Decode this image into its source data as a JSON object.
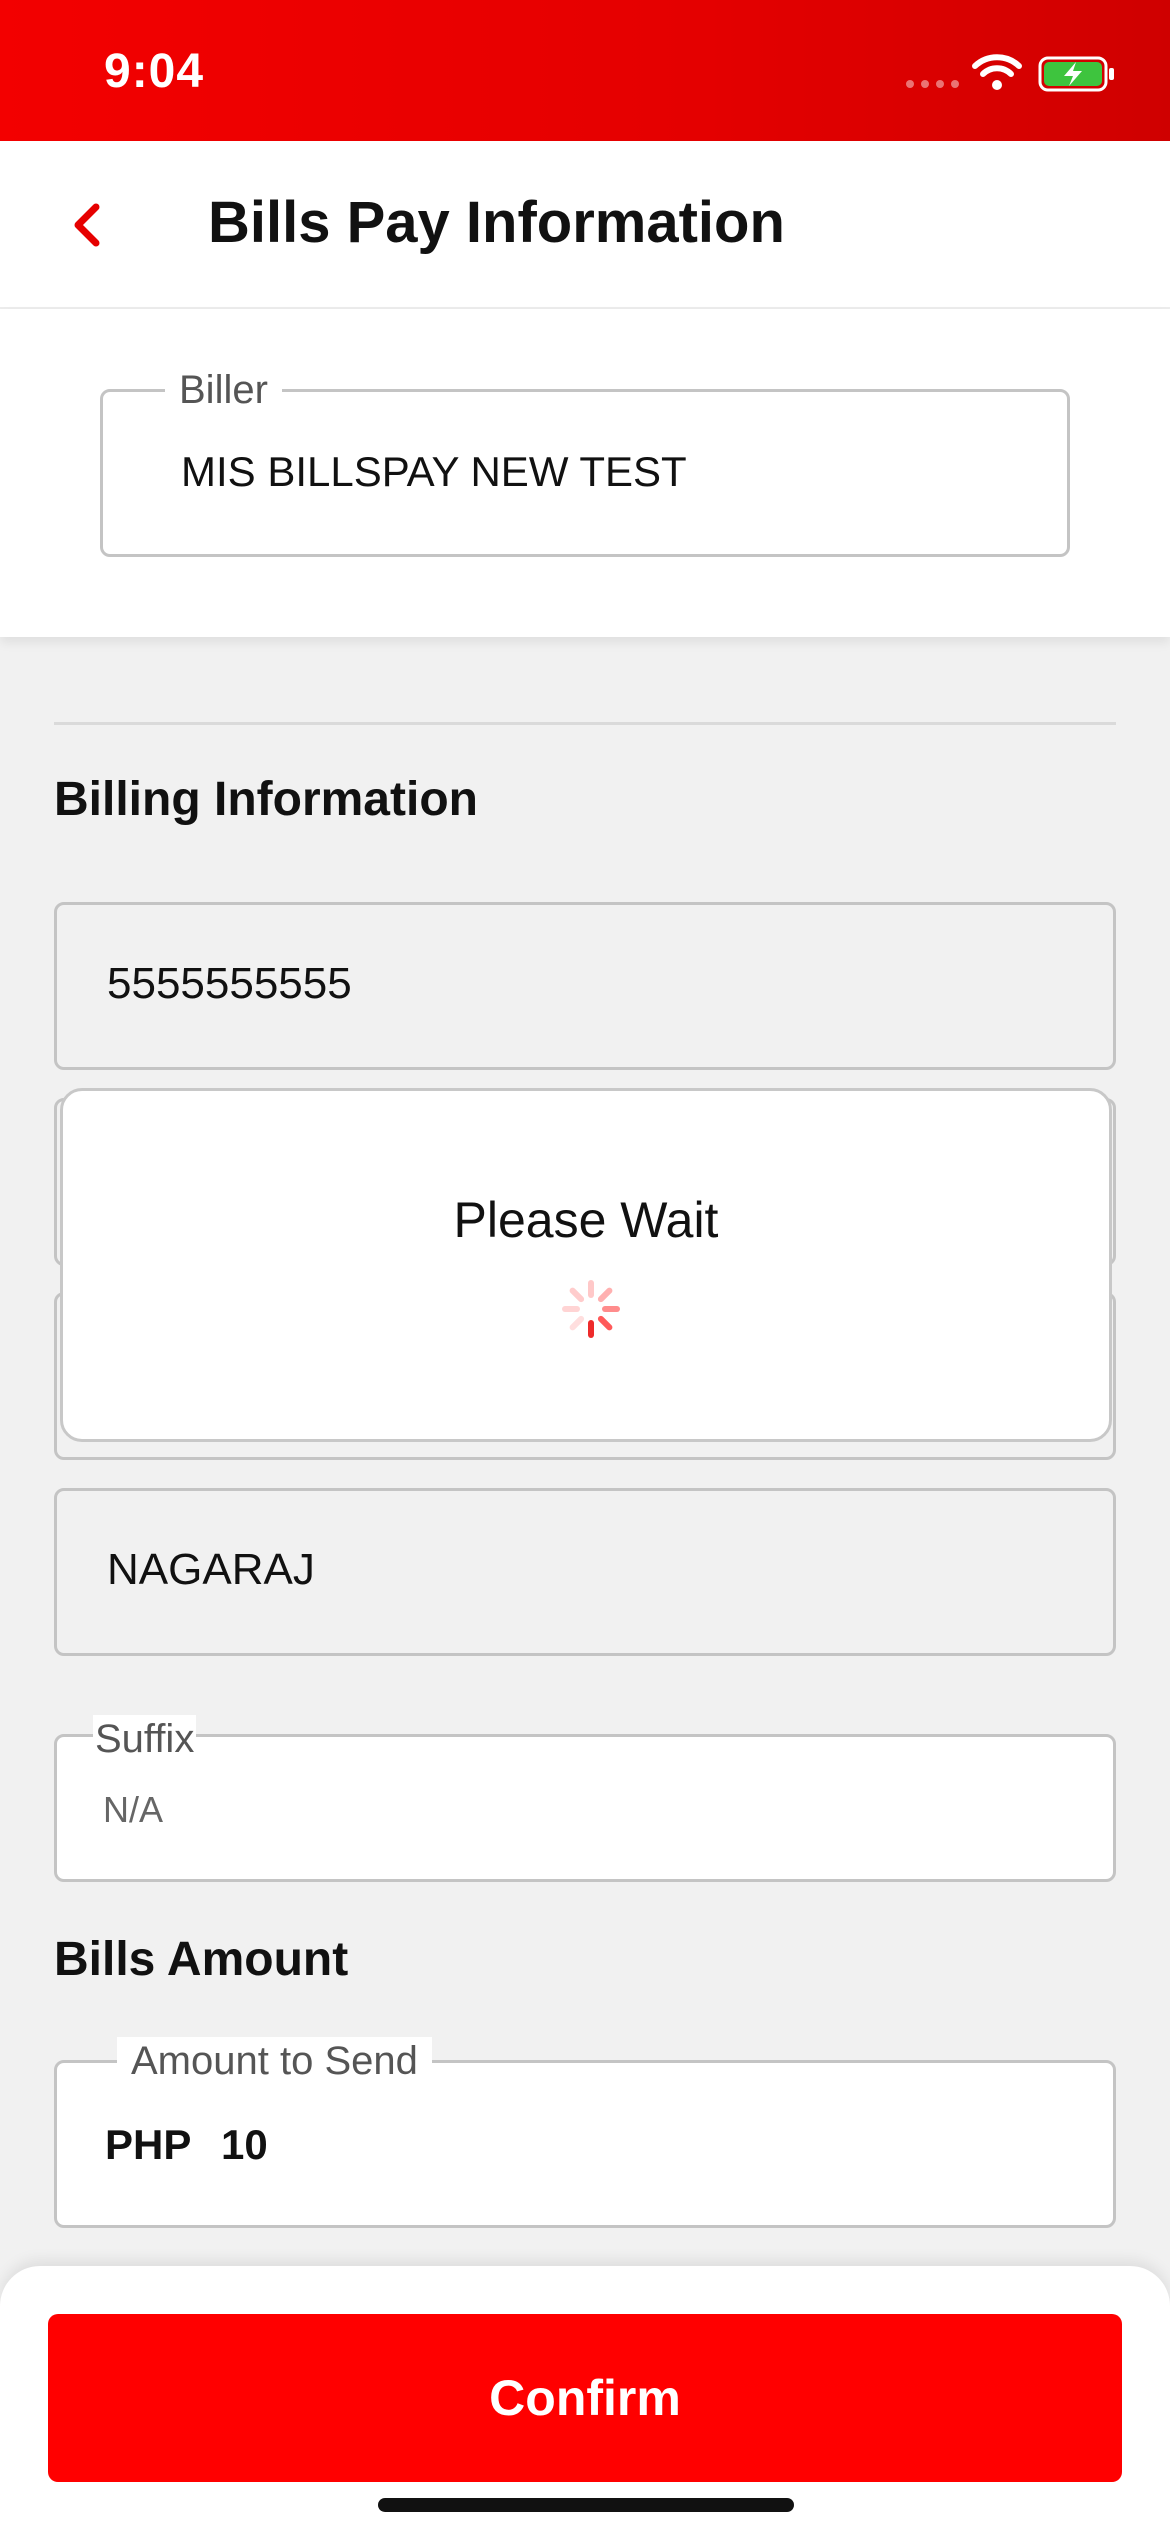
{
  "status_bar": {
    "time": "9:04"
  },
  "header": {
    "title": "Bills Pay Information"
  },
  "biller": {
    "label": "Biller",
    "value": "MIS BILLSPAY NEW TEST"
  },
  "billing_info": {
    "section_title": "Billing Information",
    "account_number": "5555555555",
    "first_name": "NAGARAJ",
    "suffix_label": "Suffix",
    "suffix_value": "N/A"
  },
  "loading": {
    "message": "Please Wait"
  },
  "bills_amount": {
    "section_title": "Bills Amount",
    "label": "Amount to Send",
    "currency": "PHP",
    "value": "10"
  },
  "footer": {
    "confirm_label": "Confirm"
  },
  "colors": {
    "brand_red": "#ff0000",
    "status_bar_red": "#e40000",
    "battery_green": "#3ec43e"
  }
}
